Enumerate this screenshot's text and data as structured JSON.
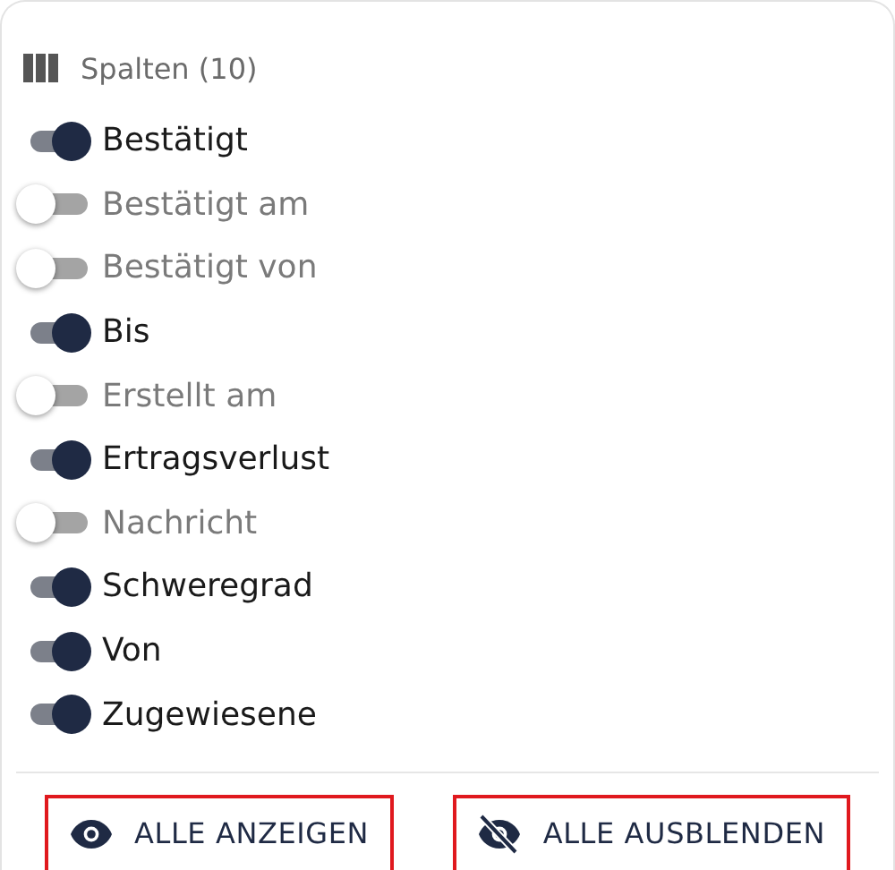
{
  "header": {
    "title": "Spalten (10)"
  },
  "columns": [
    {
      "label": "Bestätigt",
      "on": true
    },
    {
      "label": "Bestätigt am",
      "on": false
    },
    {
      "label": "Bestätigt von",
      "on": false
    },
    {
      "label": "Bis",
      "on": true
    },
    {
      "label": "Erstellt am",
      "on": false
    },
    {
      "label": "Ertragsverlust",
      "on": true
    },
    {
      "label": "Nachricht",
      "on": false
    },
    {
      "label": "Schweregrad",
      "on": true
    },
    {
      "label": "Von",
      "on": true
    },
    {
      "label": "Zugewiesene",
      "on": true
    }
  ],
  "buttons": [
    {
      "kind": "show",
      "label": "ALLE ANZEIGEN",
      "highlighted": true
    },
    {
      "kind": "hide",
      "label": "ALLE AUSBLENDEN",
      "highlighted": true
    }
  ]
}
